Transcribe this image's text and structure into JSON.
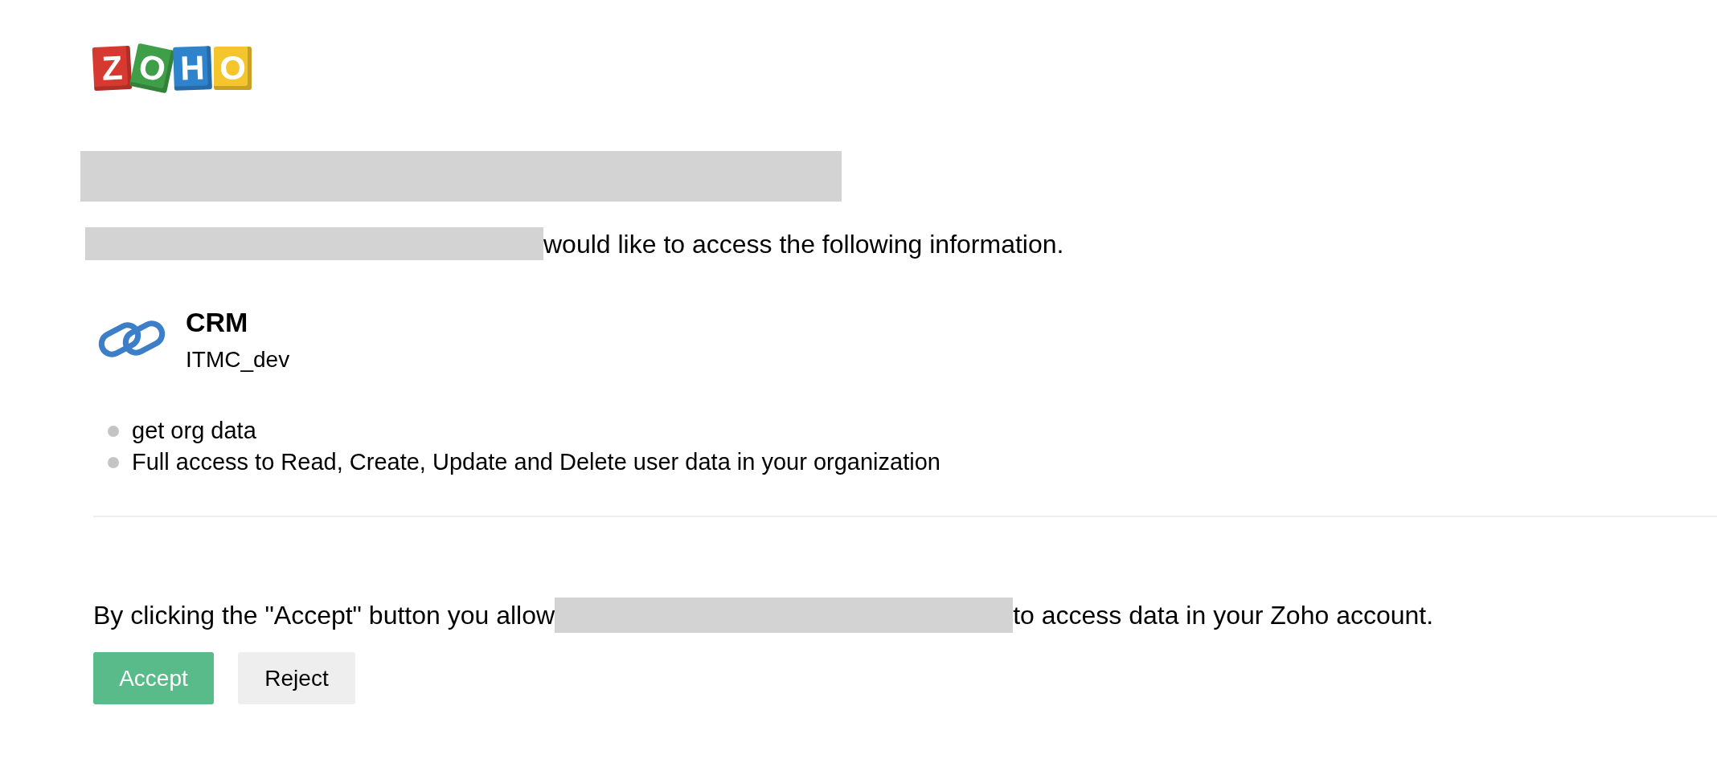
{
  "logo": {
    "letters": [
      {
        "text": "Z",
        "color": "#d6392f"
      },
      {
        "text": "O",
        "color": "#3f9e48"
      },
      {
        "text": "H",
        "color": "#2f82cc"
      },
      {
        "text": "O",
        "color": "#f4c52c"
      }
    ]
  },
  "heading": {
    "kind": "redacted"
  },
  "intro": {
    "parts": [
      {
        "kind": "redacted"
      },
      {
        "kind": "text",
        "text": "would like to access the following information."
      }
    ]
  },
  "service": {
    "name": "CRM",
    "organization": "ITMC_dev"
  },
  "permissions": [
    "get org data",
    "Full access to Read, Create, Update and Delete user data in your organization"
  ],
  "consent": {
    "parts": [
      {
        "kind": "text",
        "text": "By clicking the \"Accept\" button you allow"
      },
      {
        "kind": "redacted"
      },
      {
        "kind": "text",
        "text": "to access data in your Zoho account."
      }
    ]
  },
  "buttons": [
    {
      "label": "Accept",
      "kind": "primary"
    },
    {
      "label": "Reject",
      "kind": "secondary"
    }
  ]
}
